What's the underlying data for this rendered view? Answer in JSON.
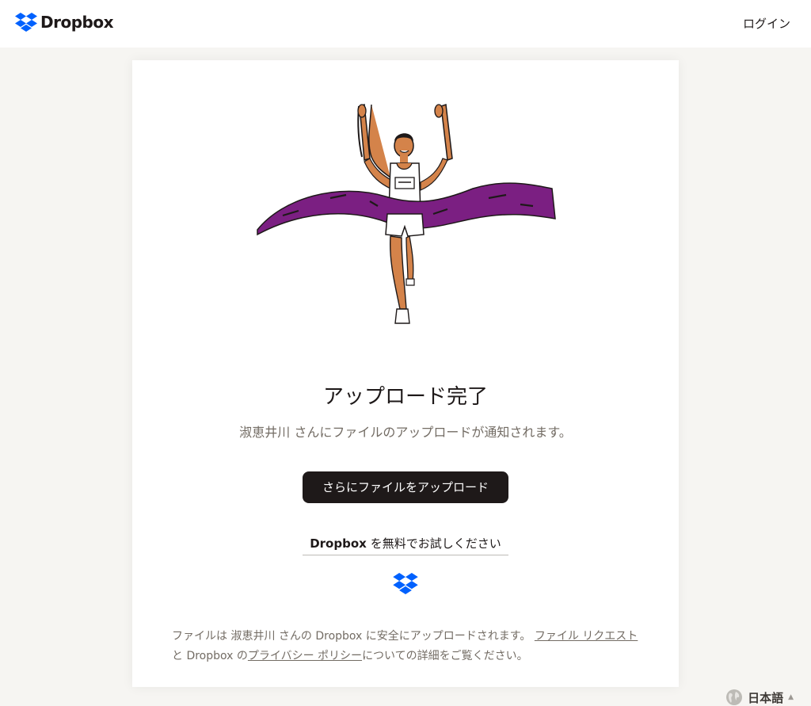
{
  "header": {
    "brand_name": "Dropbox",
    "login_label": "ログイン"
  },
  "main": {
    "heading": "アップロード完了",
    "subtext": "淑恵井川 さんにファイルのアップロードが通知されます。",
    "upload_more_label": "さらにファイルをアップロード",
    "try_free_brand": "Dropbox",
    "try_free_label": "を無料でお試しください"
  },
  "footer_note": {
    "part1": "ファイルは 淑恵井川 さんの Dropbox に安全にアップロードされます。",
    "file_request_link": "ファイル リクエスト",
    "part2": "と Dropbox の",
    "privacy_link": "プライバシー ポリシー",
    "part3": "についての詳細をご覧ください。"
  },
  "language": {
    "label": "日本語"
  },
  "colors": {
    "brand_blue": "#0061fe",
    "dark": "#1e1919",
    "muted": "#736c64",
    "background": "#f6f5f2",
    "ribbon_purple": "#7b1f82"
  }
}
